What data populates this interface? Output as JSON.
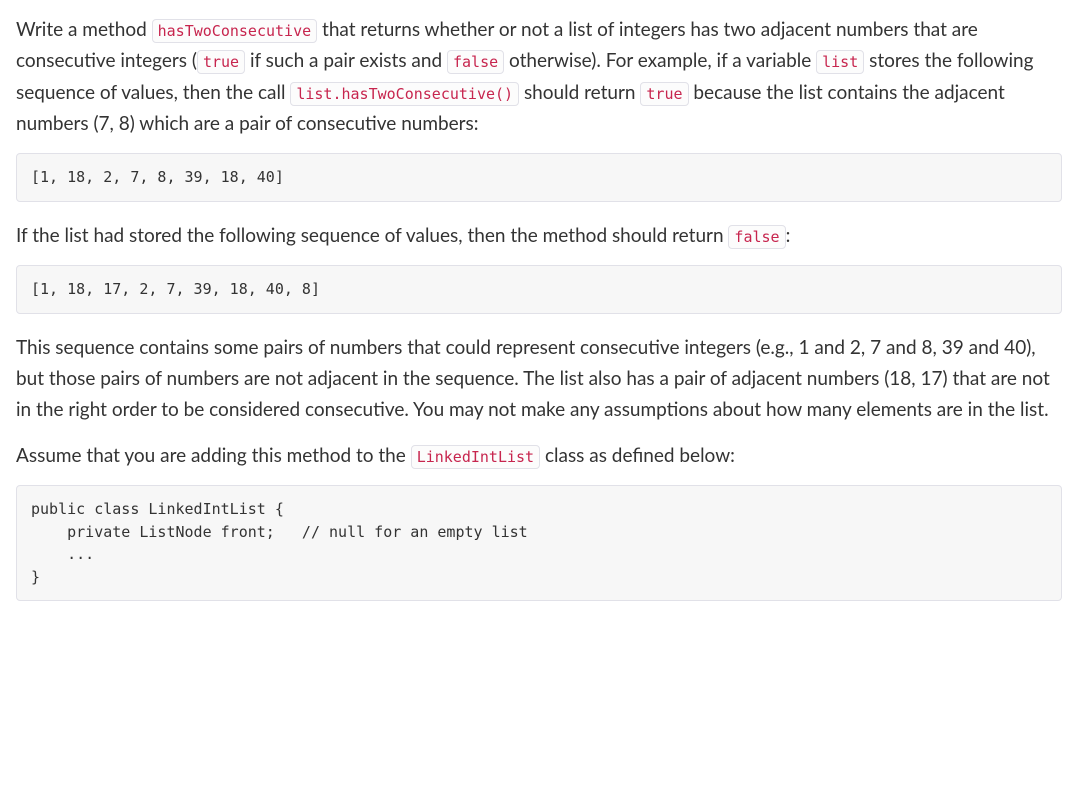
{
  "paragraph1": {
    "part1": "Write a method ",
    "code1": "hasTwoConsecutive",
    "part2": " that returns whether or not a list of integers has two adjacent numbers that are consecutive integers (",
    "code2": "true",
    "part3": " if such a pair exists and ",
    "code3": "false",
    "part4": " otherwise). For example, if a variable ",
    "code4": "list",
    "part5": " stores the following sequence of values, then the call ",
    "code5": "list.hasTwoConsecutive()",
    "part6": " should return ",
    "code6": "true",
    "part7": " because the list contains the adjacent numbers (7, 8) which are a pair of consecutive numbers:"
  },
  "codeBlock1": "[1, 18, 2, 7, 8, 39, 18, 40]",
  "paragraph2": {
    "part1": "If the list had stored the following sequence of values, then the method should return ",
    "code1": "false",
    "part2": ":"
  },
  "codeBlock2": "[1, 18, 17, 2, 7, 39, 18, 40, 8]",
  "paragraph3": "This sequence contains some pairs of numbers that could represent consecutive integers (e.g., 1 and 2, 7 and 8, 39 and 40), but those pairs of numbers are not adjacent in the sequence. The list also has a pair of adjacent numbers (18, 17) that are not in the right order to be considered consecutive. You may not make any assumptions about how many elements are in the list.",
  "paragraph4": {
    "part1": "Assume that you are adding this method to the ",
    "code1": "LinkedIntList",
    "part2": " class as defined below:"
  },
  "codeBlock3": "public class LinkedIntList {\n    private ListNode front;   // null for an empty list\n    ...\n}"
}
